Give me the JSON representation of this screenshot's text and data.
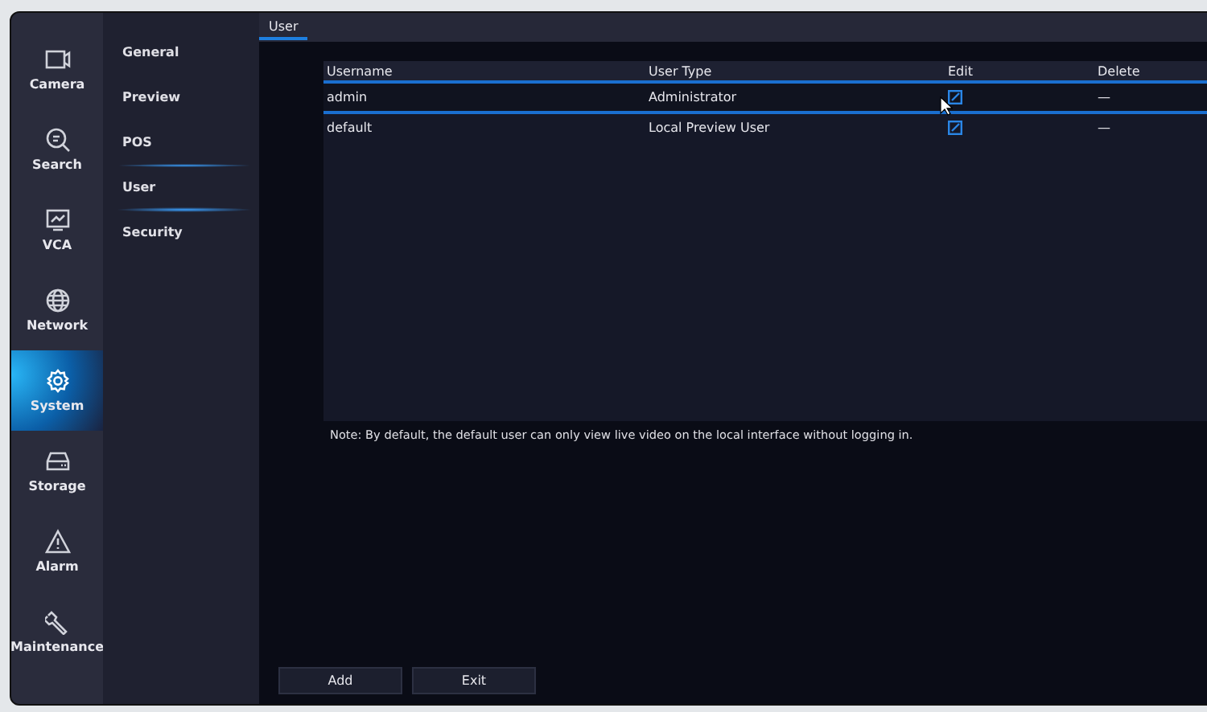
{
  "nav": [
    {
      "kind": "camera",
      "label": "Camera",
      "selected": false
    },
    {
      "kind": "search",
      "label": "Search",
      "selected": false
    },
    {
      "kind": "vca",
      "label": "VCA",
      "selected": false
    },
    {
      "kind": "network",
      "label": "Network",
      "selected": false
    },
    {
      "kind": "system",
      "label": "System",
      "selected": true
    },
    {
      "kind": "storage",
      "label": "Storage",
      "selected": false
    },
    {
      "kind": "alarm",
      "label": "Alarm",
      "selected": false
    },
    {
      "kind": "maintenance",
      "label": "Maintenance",
      "selected": false
    }
  ],
  "submenu": [
    {
      "label": "General",
      "selected": false
    },
    {
      "label": "Preview",
      "selected": false
    },
    {
      "label": "POS",
      "selected": false
    },
    {
      "label": "User",
      "selected": true
    },
    {
      "label": "Security",
      "selected": false
    }
  ],
  "tabs": [
    {
      "label": "User",
      "selected": true
    }
  ],
  "table": {
    "columns": [
      "Username",
      "User Type",
      "Edit",
      "Delete"
    ],
    "rows": [
      {
        "username": "admin",
        "user_type": "Administrator",
        "delete": "—",
        "selected": true
      },
      {
        "username": "default",
        "user_type": "Local Preview User",
        "delete": "—",
        "selected": false
      }
    ]
  },
  "note": "Note: By default, the default user can only view live video on the local interface without logging in.",
  "buttons": [
    "Add",
    "Exit"
  ]
}
